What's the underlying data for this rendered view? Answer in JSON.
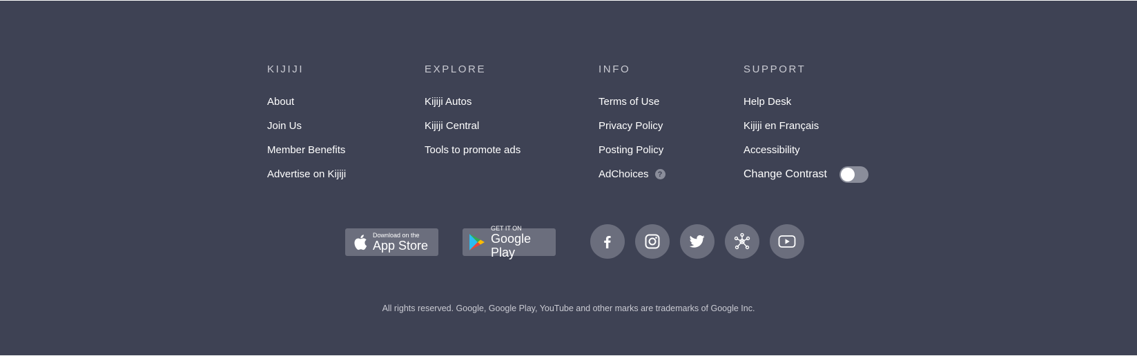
{
  "columns": {
    "kijiji": {
      "heading": "KIJIJI",
      "links": [
        "About",
        "Join Us",
        "Member Benefits",
        "Advertise on Kijiji"
      ]
    },
    "explore": {
      "heading": "EXPLORE",
      "links": [
        "Kijiji Autos",
        "Kijiji Central",
        "Tools to promote ads"
      ]
    },
    "info": {
      "heading": "INFO",
      "links": [
        "Terms of Use",
        "Privacy Policy",
        "Posting Policy",
        "AdChoices"
      ],
      "help_badge": "?"
    },
    "support": {
      "heading": "SUPPORT",
      "links": [
        "Help Desk",
        "Kijiji en Français",
        "Accessibility"
      ],
      "contrast_label": "Change Contrast",
      "contrast_on": false
    }
  },
  "app_store": {
    "small": "Download on the",
    "big": "App Store"
  },
  "google_play": {
    "small": "GET IT ON",
    "big": "Google Play"
  },
  "social_icons": [
    "facebook-icon",
    "instagram-icon",
    "twitter-icon",
    "network-icon",
    "youtube-icon"
  ],
  "legal": "All rights reserved. Google, Google Play, YouTube and other marks are trademarks of Google Inc.",
  "colors": {
    "background": "#3e4254",
    "badge": "#6b6e7d",
    "heading": "#c9cad2"
  }
}
